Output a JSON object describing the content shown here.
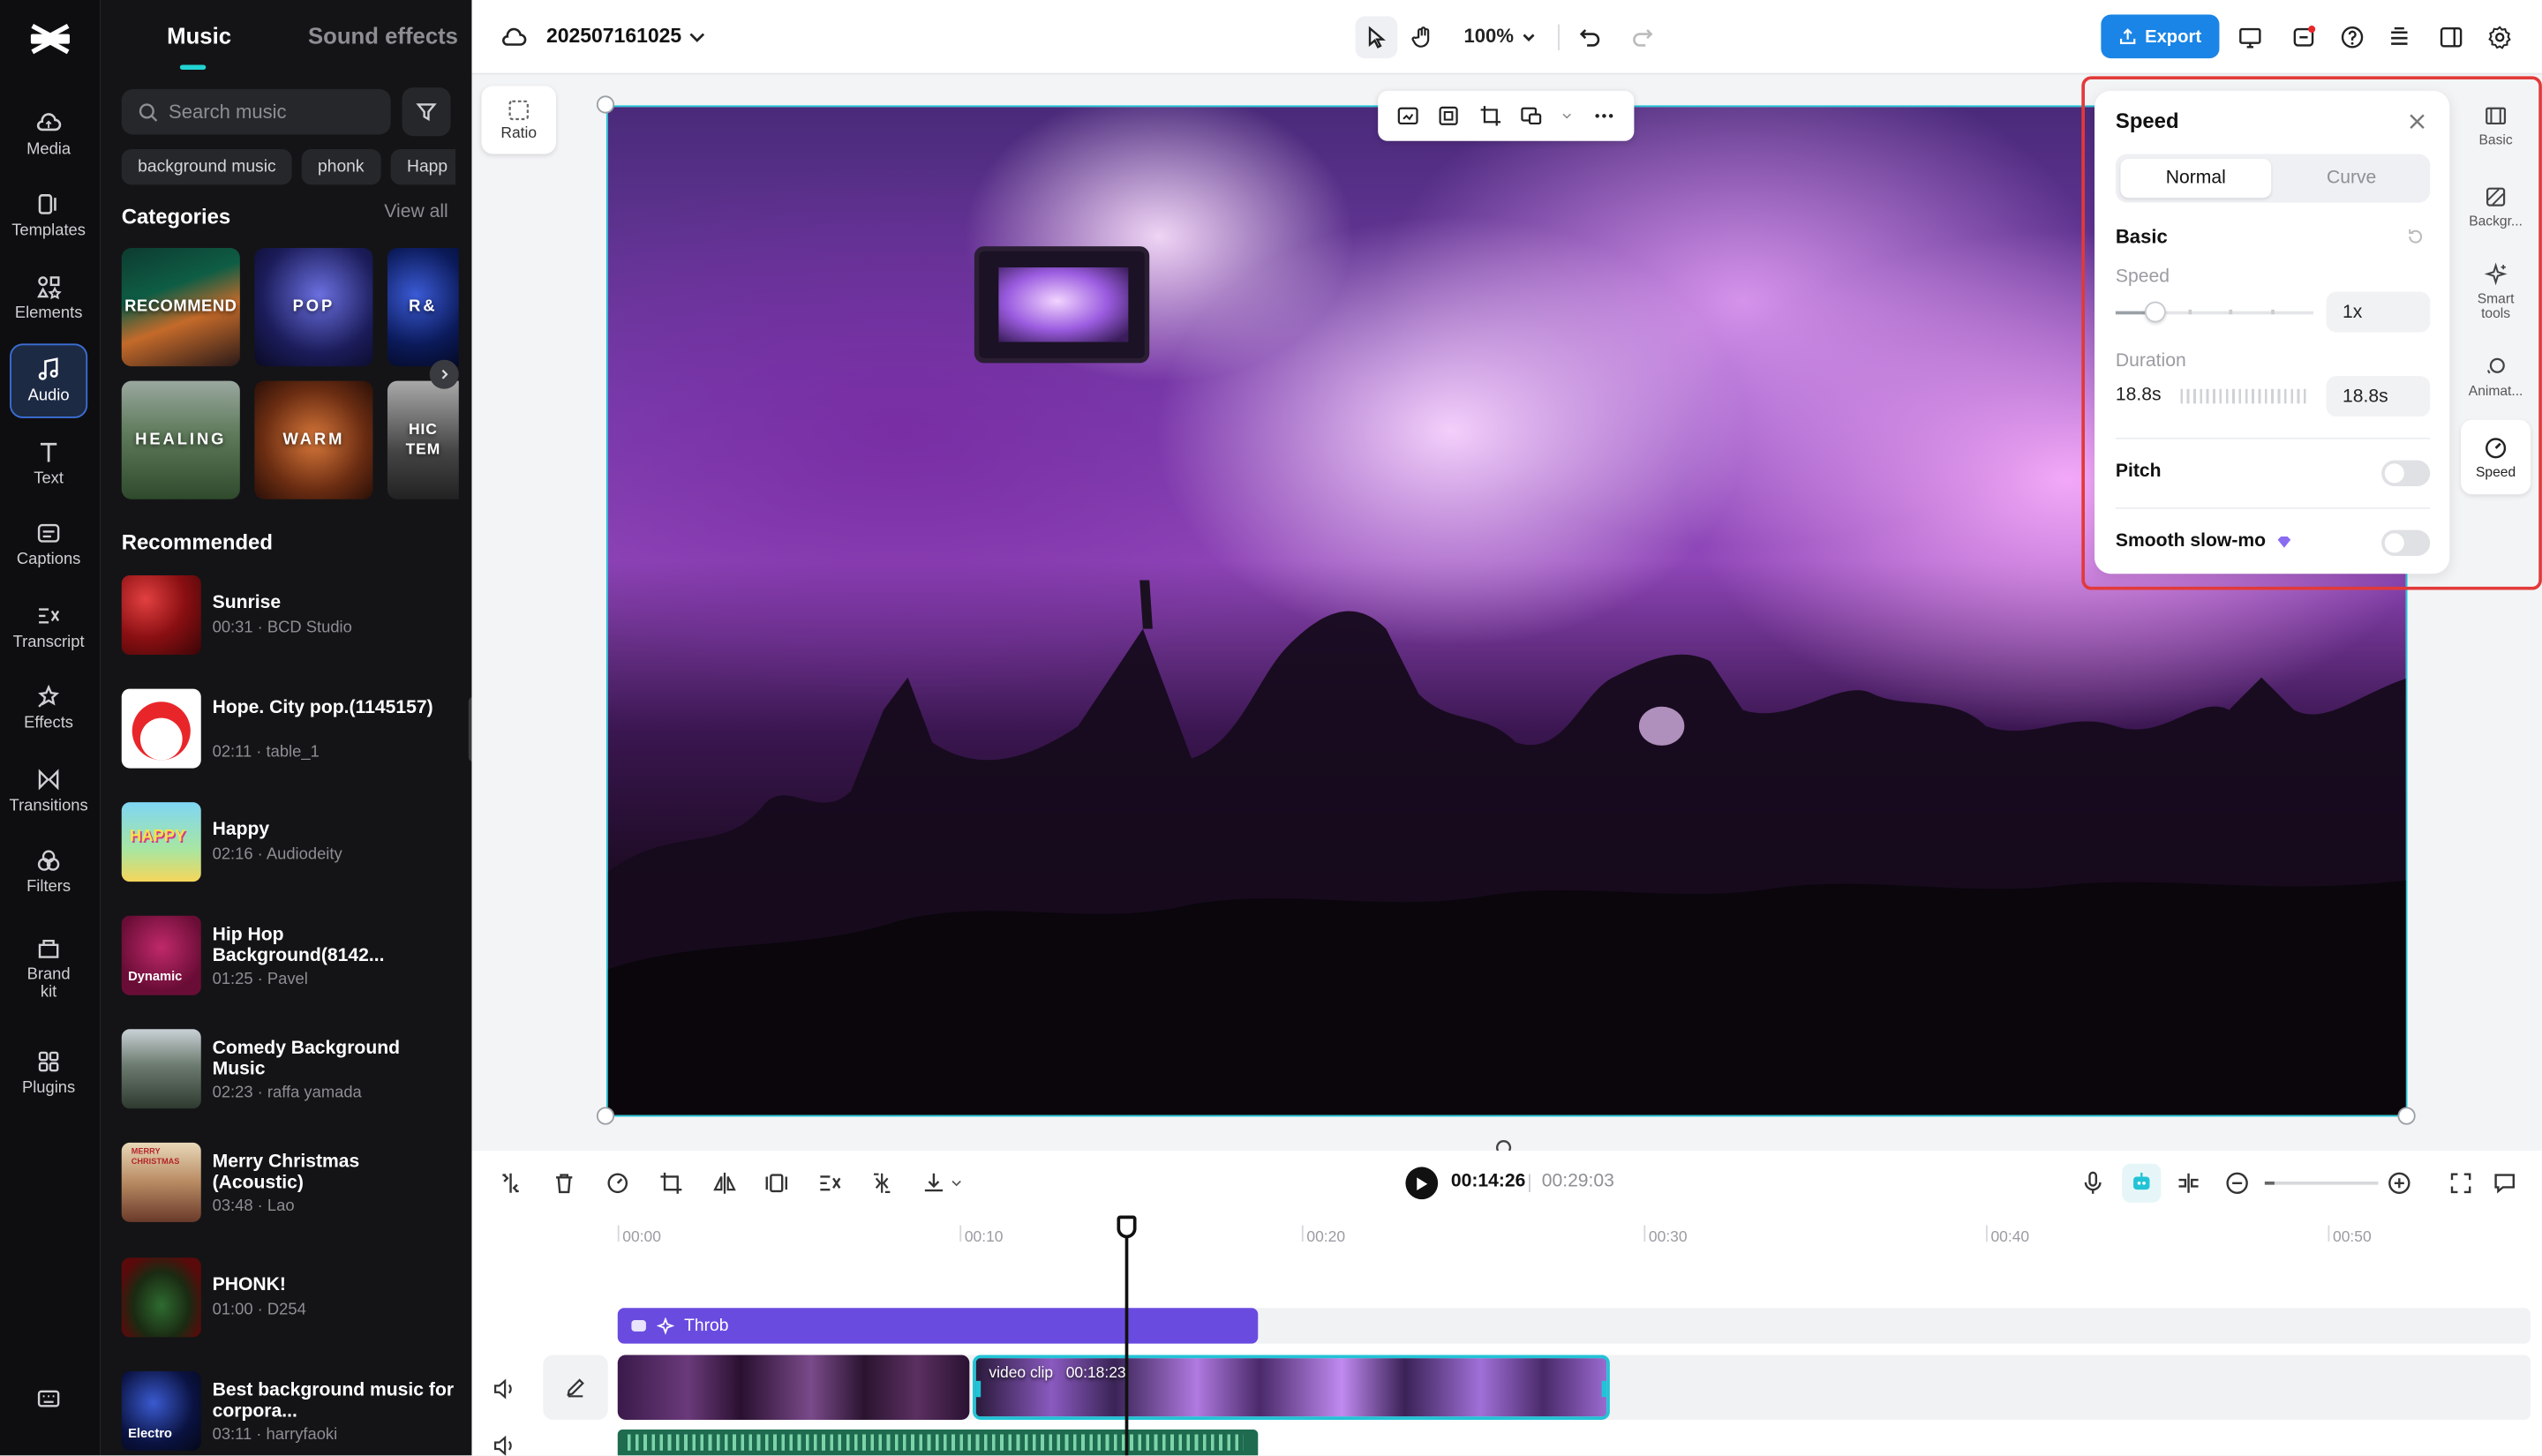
{
  "rail": {
    "items": [
      {
        "label": "Media",
        "icon": "media-icon"
      },
      {
        "label": "Templates",
        "icon": "templates-icon"
      },
      {
        "label": "Elements",
        "icon": "elements-icon"
      },
      {
        "label": "Audio",
        "icon": "audio-icon"
      },
      {
        "label": "Text",
        "icon": "text-icon"
      },
      {
        "label": "Captions",
        "icon": "captions-icon"
      },
      {
        "label": "Transcript",
        "icon": "transcript-icon"
      },
      {
        "label": "Effects",
        "icon": "effects-icon"
      },
      {
        "label": "Transitions",
        "icon": "transitions-icon"
      },
      {
        "label": "Filters",
        "icon": "filters-icon"
      },
      {
        "label": "Brand kit",
        "icon": "brand-kit-icon"
      },
      {
        "label": "Plugins",
        "icon": "plugins-icon"
      }
    ],
    "active": "Audio"
  },
  "panel": {
    "tabs": [
      "Music",
      "Sound effects"
    ],
    "search_placeholder": "Search music",
    "chips": [
      "background music",
      "phonk",
      "Happ"
    ],
    "categories_title": "Categories",
    "view_all": "View all",
    "categories": [
      "RECOMMEND",
      "POP",
      "R&",
      "HEALING",
      "WARM",
      "HIC TEM"
    ],
    "recommended_title": "Recommended",
    "tracks": [
      {
        "title": "Sunrise",
        "meta": "00:31 · BCD Studio"
      },
      {
        "title": "Hope. City pop.(1145157)",
        "meta": "02:11 · table_1"
      },
      {
        "title": "Happy",
        "meta": "02:16 · Audiodeity",
        "thumb_text": "HAPPY"
      },
      {
        "title": "Hip Hop Background(8142...",
        "meta": "01:25 · Pavel",
        "thumb_text": "Dynamic"
      },
      {
        "title": "Comedy Background Music",
        "meta": "02:23 · raffa yamada"
      },
      {
        "title": "Merry Christmas (Acoustic)",
        "meta": "03:48 · Lao",
        "thumb_text": "MERRY CHRISTMAS"
      },
      {
        "title": "PHONK!",
        "meta": "01:00 · D254"
      },
      {
        "title": "Best background music for corpora...",
        "meta": "03:11 · harryfaoki",
        "thumb_text": "Electro"
      }
    ]
  },
  "topbar": {
    "project_name": "202507161025",
    "zoom": "100%",
    "export_label": "Export"
  },
  "canvas": {
    "ratio_label": "Ratio"
  },
  "speed_panel": {
    "title": "Speed",
    "modes": [
      "Normal",
      "Curve"
    ],
    "active_mode": "Normal",
    "section": "Basic",
    "speed_label": "Speed",
    "speed_value": "1x",
    "duration_label": "Duration",
    "duration_left": "18.8s",
    "duration_value": "18.8s",
    "pitch_label": "Pitch",
    "pitch_on": false,
    "smooth_label": "Smooth slow-mo",
    "smooth_on": false
  },
  "right_rail": {
    "items": [
      {
        "label": "Basic",
        "icon": "basic-icon"
      },
      {
        "label": "Backgr...",
        "icon": "background-icon"
      },
      {
        "label": "Smart tools",
        "icon": "smart-tools-icon"
      },
      {
        "label": "Animat...",
        "icon": "animation-icon"
      },
      {
        "label": "Speed",
        "icon": "speed-icon"
      }
    ],
    "active": "Speed"
  },
  "timeline": {
    "current_time": "00:14:26",
    "separator": "|",
    "total_time": "00:29:03",
    "ticks": [
      "00:00",
      "00:10",
      "00:20",
      "00:30",
      "00:40",
      "00:50"
    ],
    "effect_clip": "Throb",
    "video_clip_label": "video clip",
    "video_clip_duration": "00:18:23"
  },
  "colors": {
    "accent": "#1a85e6",
    "selection": "#22c3d6",
    "effect_track": "#6a4be0",
    "highlight": "#e23a3a"
  }
}
